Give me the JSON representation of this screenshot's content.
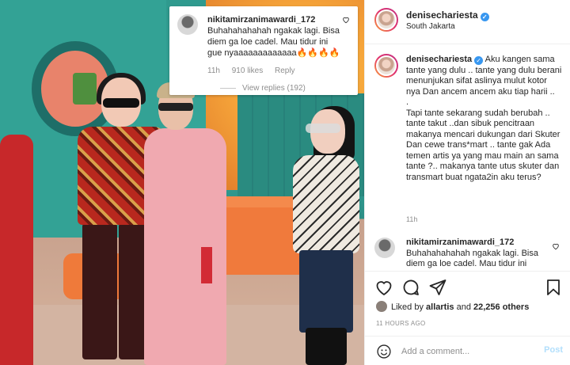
{
  "overlay": {
    "username": "nikitamirzanimawardi_172",
    "text": "Buhahahahahah ngakak lagi. Bisa diem ga loe cadel. Mau tidur ini gue nyaaaaaaaaaaaaa🔥🔥🔥🔥",
    "time": "11h",
    "likes": "910 likes",
    "reply": "Reply",
    "view_replies": "View replies (192)"
  },
  "header": {
    "username": "denisechariesta",
    "location": "South Jakarta"
  },
  "caption": {
    "username": "denisechariesta",
    "text": "Aku kangen sama tante yang dulu .. tante yang dulu berani menunjukan sifat aslinya mulut kotor nya Dan ancem ancem aku tiap harii ..\n.\nTapi tante sekarang sudah berubah .. tante takut ..dan sibuk pencitraan makanya mencari dukungan dari Skuter Dan cewe trans*mart .. tante gak Ada temen artis ya yang mau main an sama tante ?.. makanya tante utus skuter dan transmart buat ngata2in aku terus?",
    "time": "11h"
  },
  "comment": {
    "username": "nikitamirzanimawardi_172",
    "text": "Buhahahahahah ngakak lagi. Bisa diem ga loe cadel. Mau tidur ini"
  },
  "likes": {
    "prefix": "Liked by",
    "user": "allartis",
    "conj": "and",
    "others": "22,256 others"
  },
  "timeago": "11 HOURS AGO",
  "add_comment": {
    "placeholder": "Add a comment...",
    "post": "Post"
  },
  "icons": {
    "verified": "verified-badge-icon",
    "heart": "heart-icon",
    "comment": "comment-icon",
    "share": "share-icon",
    "save": "bookmark-icon",
    "emoji": "emoji-icon"
  },
  "colors": {
    "verified": "#3897f0",
    "muted": "#8e8e8e",
    "post_disabled": "#b2dffc",
    "text": "#262626"
  }
}
